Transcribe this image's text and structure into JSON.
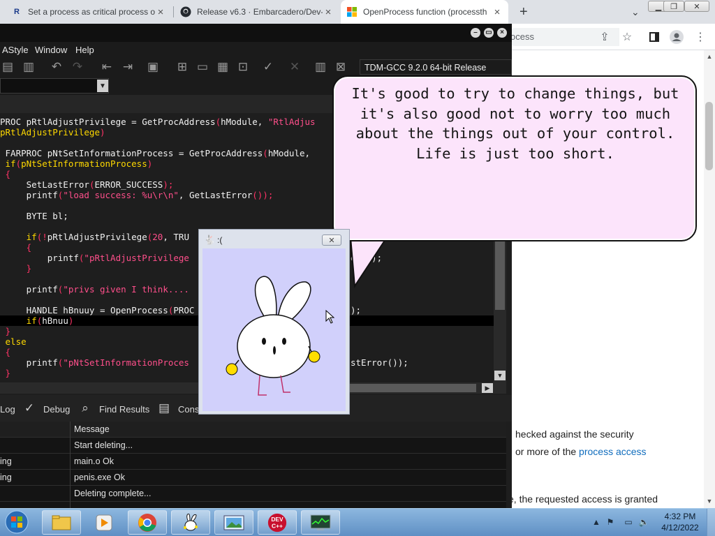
{
  "browser": {
    "tabs": [
      {
        "title": "Set a process as critical process o",
        "favicon": "R"
      },
      {
        "title": "Release v6.3 · Embarcadero/Dev-",
        "favicon": "github-icon"
      },
      {
        "title": "OpenProcess function (processth",
        "favicon": "microsoft-icon"
      }
    ],
    "new_tab": "+",
    "address_fragment": "ocess"
  },
  "web_page": {
    "lines": [
      {
        "text": "hecked against the security"
      },
      {
        "pre": " or more of the ",
        "link": "process access"
      },
      {
        "text": "e, the requested access is granted"
      }
    ]
  },
  "ide": {
    "menu": [
      "AStyle",
      "Window",
      "Help"
    ],
    "compiler": "TDM-GCC 9.2.0 64-bit Release",
    "code_lines": [
      [
        {
          "t": "PROC pRtlAdjustPrivilege = GetProcAddress",
          "c": "fn"
        },
        {
          "t": "(",
          "c": "br"
        },
        {
          "t": "hModule, ",
          "c": "fn"
        },
        {
          "t": "\"RtlAdjus",
          "c": "str"
        }
      ],
      [
        {
          "t": "pRtlAdjustPrivilege",
          "c": "kw"
        },
        {
          "t": ")",
          "c": "br"
        }
      ],
      [
        {
          "t": "",
          "c": "fn"
        }
      ],
      [
        {
          "t": " FARPROC pNtSetInformationProcess = GetProcAddress",
          "c": "fn"
        },
        {
          "t": "(",
          "c": "br"
        },
        {
          "t": "hModule,",
          "c": "fn"
        }
      ],
      [
        {
          "t": " if",
          "c": "kw"
        },
        {
          "t": "(",
          "c": "br"
        },
        {
          "t": "pNtSetInformationProcess",
          "c": "kw"
        },
        {
          "t": ")",
          "c": "br"
        }
      ],
      [
        {
          "t": " {",
          "c": "br"
        }
      ],
      [
        {
          "t": "     SetLastError",
          "c": "fn"
        },
        {
          "t": "(",
          "c": "br"
        },
        {
          "t": "ERROR_SUCCESS",
          "c": "fn"
        },
        {
          "t": ");",
          "c": "br"
        }
      ],
      [
        {
          "t": "     printf",
          "c": "fn"
        },
        {
          "t": "(",
          "c": "br"
        },
        {
          "t": "\"load success: %u\\r\\n\"",
          "c": "str"
        },
        {
          "t": ", GetLastError",
          "c": "fn"
        },
        {
          "t": "());",
          "c": "br"
        }
      ],
      [
        {
          "t": "",
          "c": "fn"
        }
      ],
      [
        {
          "t": "     BYTE bl;",
          "c": "fn"
        }
      ],
      [
        {
          "t": "",
          "c": "fn"
        }
      ],
      [
        {
          "t": "     if",
          "c": "kw"
        },
        {
          "t": "(!",
          "c": "br"
        },
        {
          "t": "pRtlAdjustPrivilege",
          "c": "fn"
        },
        {
          "t": "(",
          "c": "br"
        },
        {
          "t": "20",
          "c": "str"
        },
        {
          "t": ", TRU",
          "c": "fn"
        }
      ],
      [
        {
          "t": "     {",
          "c": "br"
        }
      ],
      [
        {
          "t": "         printf",
          "c": "fn"
        },
        {
          "t": "(",
          "c": "br"
        },
        {
          "t": "\"pRtlAdjustPrivilege",
          "c": "str"
        }
      ],
      [
        {
          "t": "     }",
          "c": "br"
        }
      ],
      [
        {
          "t": "",
          "c": "fn"
        }
      ],
      [
        {
          "t": "     printf",
          "c": "fn"
        },
        {
          "t": "(",
          "c": "br"
        },
        {
          "t": "\"privs given I think....",
          "c": "str"
        }
      ],
      [
        {
          "t": "",
          "c": "fn"
        }
      ],
      [
        {
          "t": "     HANDLE hBnuuy = OpenProcess",
          "c": "fn"
        },
        {
          "t": "(",
          "c": "br"
        },
        {
          "t": "PROC",
          "c": "fn"
        }
      ],
      [
        {
          "t": "     if",
          "c": "kw"
        },
        {
          "t": "(",
          "c": "br"
        },
        {
          "t": "hBnuu",
          "c": "fn"
        },
        {
          "t": ")",
          "c": "br"
        }
      ],
      [
        {
          "t": " }",
          "c": "br"
        }
      ],
      [
        {
          "t": " else",
          "c": "kw"
        }
      ],
      [
        {
          "t": " {",
          "c": "br"
        }
      ],
      [
        {
          "t": "     printf",
          "c": "fn"
        },
        {
          "t": "(",
          "c": "br"
        },
        {
          "t": "\"pNtSetInformationProces",
          "c": "str"
        }
      ],
      [
        {
          "t": " }",
          "c": "br"
        }
      ]
    ],
    "code_right": [
      {
        "line": 13,
        "t": "or());"
      },
      {
        "line": 18,
        "t": ");"
      },
      {
        "line": 23,
        "t": "stError());"
      }
    ],
    "bottom_tabs": [
      "Log",
      "Debug",
      "Find Results",
      "Cons"
    ],
    "messages_header": "Message",
    "messages": [
      {
        "col1": "",
        "col2": "Start deleting..."
      },
      {
        "col1": "ing",
        "col2": "main.o Ok"
      },
      {
        "col1": "ing",
        "col2": "penis.exe Ok"
      },
      {
        "col1": "",
        "col2": "Deleting complete..."
      }
    ]
  },
  "bubble": {
    "text_lines": [
      "It's good to try to change things, but",
      "it's also good not to worry too much",
      "about the things out of your control.",
      "Life is just too short."
    ]
  },
  "bunny_window": {
    "title": ":("
  },
  "taskbar": {
    "apps": [
      "explorer",
      "media-player",
      "chrome",
      "bunny",
      "photo-viewer",
      "dev-cpp",
      "task-manager"
    ],
    "dev_label_top": "DEV",
    "dev_label_bottom": "C++",
    "time": "4:32 PM",
    "date": "4/12/2022"
  },
  "colors": {
    "ide_bg": "#1e1e1e",
    "keyword": "#ffd900",
    "string": "#ff4f8b",
    "bubble": "#fce4fb",
    "bunny_bg": "#d1d0fb"
  }
}
